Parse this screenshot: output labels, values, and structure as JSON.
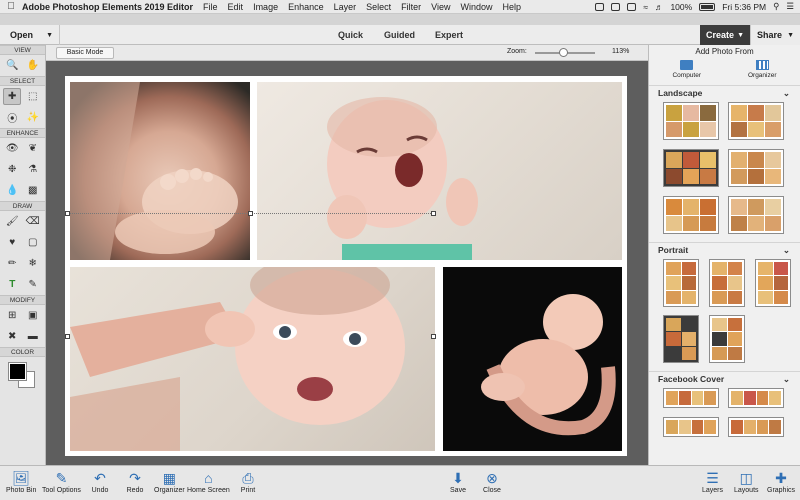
{
  "menubar": {
    "app_name": "Adobe Photoshop Elements 2019 Editor",
    "menus": [
      "File",
      "Edit",
      "Image",
      "Enhance",
      "Layer",
      "Select",
      "Filter",
      "View",
      "Window",
      "Help"
    ],
    "battery": "100%",
    "clock": "Fri 5:36 PM"
  },
  "modebar": {
    "open_label": "Open",
    "tabs": [
      "Quick",
      "Guided",
      "Expert"
    ],
    "create_label": "Create",
    "share_label": "Share"
  },
  "tools": {
    "sections": [
      "VIEW",
      "SELECT",
      "ENHANCE",
      "DRAW",
      "MODIFY",
      "COLOR"
    ]
  },
  "options": {
    "basic_mode": "Basic Mode",
    "zoom_label": "Zoom:",
    "zoom_value": "113%",
    "zoom_fraction": 0.45
  },
  "rpanel": {
    "add_photo_from": "Add Photo From",
    "sources": [
      "Computer",
      "Organizer"
    ],
    "categories": [
      "Landscape",
      "Portrait",
      "Facebook Cover"
    ]
  },
  "bottombar": {
    "items": [
      "Photo Bin",
      "Tool Options",
      "Undo",
      "Redo",
      "Organizer",
      "Home Screen",
      "Print",
      "Save",
      "Close",
      "Layers",
      "Layouts",
      "Graphics"
    ]
  },
  "colors": {
    "accent": "#2f6fb4",
    "create_bg": "#3b3b3b",
    "canvas_bg": "#5e5e5e"
  }
}
